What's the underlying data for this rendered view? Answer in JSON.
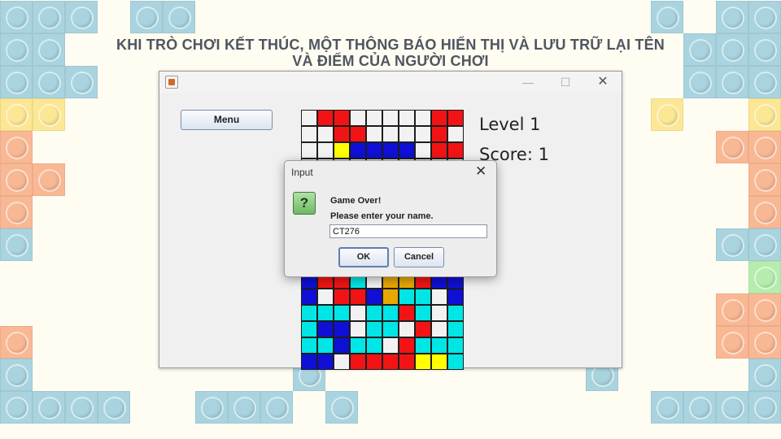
{
  "slide": {
    "headline_line1": "KHI TRÒ CHƠI KẾT THÚC, MỘT THÔNG BÁO HIỂN THỊ VÀ LƯU TRỮ LẠI TÊN",
    "headline_line2": "VÀ ĐIỂM CỦA NGƯỜI CHƠI"
  },
  "window": {
    "minimize_glyph": "—",
    "maximize_glyph": "☐",
    "close_glyph": "✕",
    "menu_button": "Menu",
    "level_text": "Level 1",
    "score_text": "Score: 1"
  },
  "dialog": {
    "title": "Input",
    "close_glyph": "✕",
    "icon_glyph": "?",
    "message_line1": "Game Over!",
    "message_line2": "Please enter your name.",
    "input_value": "CT276",
    "ok_label": "OK",
    "cancel_label": "Cancel"
  },
  "colors": {
    "W": "#f2f2f2",
    "R": "#f21414",
    "B": "#0f0fd6",
    "Y": "#ffff00",
    "C": "#00e6e6",
    "O": "#e8a800",
    "bricks": {
      "b": "#a9d4df",
      "y": "#fce794",
      "o": "#f9b894",
      "g": "#b6edae"
    }
  },
  "board": {
    "cols": 10,
    "rows": [
      "WRRWWWWWRR",
      "WWRRWWWWRW",
      "WWYBBBBWRR",
      "WWWWWWWWWW",
      "WWWWWWWWWW",
      "WWWWWWWWWW",
      "WWWWWWWWWW",
      "WWWWWWWWWW",
      "WWWWWWWWWW",
      "WWWWWWWWWW",
      "BRRCWOORBB",
      "BWRRBOCCWB",
      "CCCWCCRCWC",
      "CBBWCCWRWC",
      "CCBCCWRCCC",
      "BBWRRRRYYC"
    ]
  },
  "background_bricks": [
    {
      "c": 0,
      "r": 0,
      "t": "b"
    },
    {
      "c": 1,
      "r": 0,
      "t": "b"
    },
    {
      "c": 2,
      "r": 0,
      "t": "b"
    },
    {
      "c": 4,
      "r": 0,
      "t": "b"
    },
    {
      "c": 5,
      "r": 0,
      "t": "b"
    },
    {
      "c": 20,
      "r": 0,
      "t": "b"
    },
    {
      "c": 22,
      "r": 0,
      "t": "b"
    },
    {
      "c": 23,
      "r": 0,
      "t": "b"
    },
    {
      "c": 0,
      "r": 1,
      "t": "b"
    },
    {
      "c": 1,
      "r": 1,
      "t": "b"
    },
    {
      "c": 21,
      "r": 1,
      "t": "b"
    },
    {
      "c": 22,
      "r": 1,
      "t": "b"
    },
    {
      "c": 23,
      "r": 1,
      "t": "b"
    },
    {
      "c": 0,
      "r": 2,
      "t": "b"
    },
    {
      "c": 1,
      "r": 2,
      "t": "b"
    },
    {
      "c": 2,
      "r": 2,
      "t": "b"
    },
    {
      "c": 21,
      "r": 2,
      "t": "b"
    },
    {
      "c": 22,
      "r": 2,
      "t": "b"
    },
    {
      "c": 23,
      "r": 2,
      "t": "b"
    },
    {
      "c": 0,
      "r": 3,
      "t": "y"
    },
    {
      "c": 1,
      "r": 3,
      "t": "y"
    },
    {
      "c": 20,
      "r": 3,
      "t": "y"
    },
    {
      "c": 23,
      "r": 3,
      "t": "y"
    },
    {
      "c": 0,
      "r": 4,
      "t": "o"
    },
    {
      "c": 22,
      "r": 4,
      "t": "o"
    },
    {
      "c": 23,
      "r": 4,
      "t": "o"
    },
    {
      "c": 0,
      "r": 5,
      "t": "o"
    },
    {
      "c": 1,
      "r": 5,
      "t": "o"
    },
    {
      "c": 23,
      "r": 5,
      "t": "o"
    },
    {
      "c": 0,
      "r": 6,
      "t": "o"
    },
    {
      "c": 23,
      "r": 6,
      "t": "o"
    },
    {
      "c": 0,
      "r": 7,
      "t": "b"
    },
    {
      "c": 22,
      "r": 7,
      "t": "b"
    },
    {
      "c": 23,
      "r": 7,
      "t": "b"
    },
    {
      "c": 23,
      "r": 8,
      "t": "g"
    },
    {
      "c": 22,
      "r": 9,
      "t": "o"
    },
    {
      "c": 23,
      "r": 9,
      "t": "o"
    },
    {
      "c": 0,
      "r": 10,
      "t": "o"
    },
    {
      "c": 22,
      "r": 10,
      "t": "o"
    },
    {
      "c": 23,
      "r": 10,
      "t": "o"
    },
    {
      "c": 0,
      "r": 11,
      "t": "b"
    },
    {
      "c": 9,
      "r": 11,
      "t": "b"
    },
    {
      "c": 18,
      "r": 11,
      "t": "b"
    },
    {
      "c": 23,
      "r": 11,
      "t": "b"
    },
    {
      "c": 0,
      "r": 12,
      "t": "b"
    },
    {
      "c": 1,
      "r": 12,
      "t": "b"
    },
    {
      "c": 2,
      "r": 12,
      "t": "b"
    },
    {
      "c": 3,
      "r": 12,
      "t": "b"
    },
    {
      "c": 6,
      "r": 12,
      "t": "b"
    },
    {
      "c": 7,
      "r": 12,
      "t": "b"
    },
    {
      "c": 8,
      "r": 12,
      "t": "b"
    },
    {
      "c": 10,
      "r": 12,
      "t": "b"
    },
    {
      "c": 20,
      "r": 12,
      "t": "b"
    },
    {
      "c": 21,
      "r": 12,
      "t": "b"
    },
    {
      "c": 22,
      "r": 12,
      "t": "b"
    },
    {
      "c": 23,
      "r": 12,
      "t": "b"
    }
  ]
}
